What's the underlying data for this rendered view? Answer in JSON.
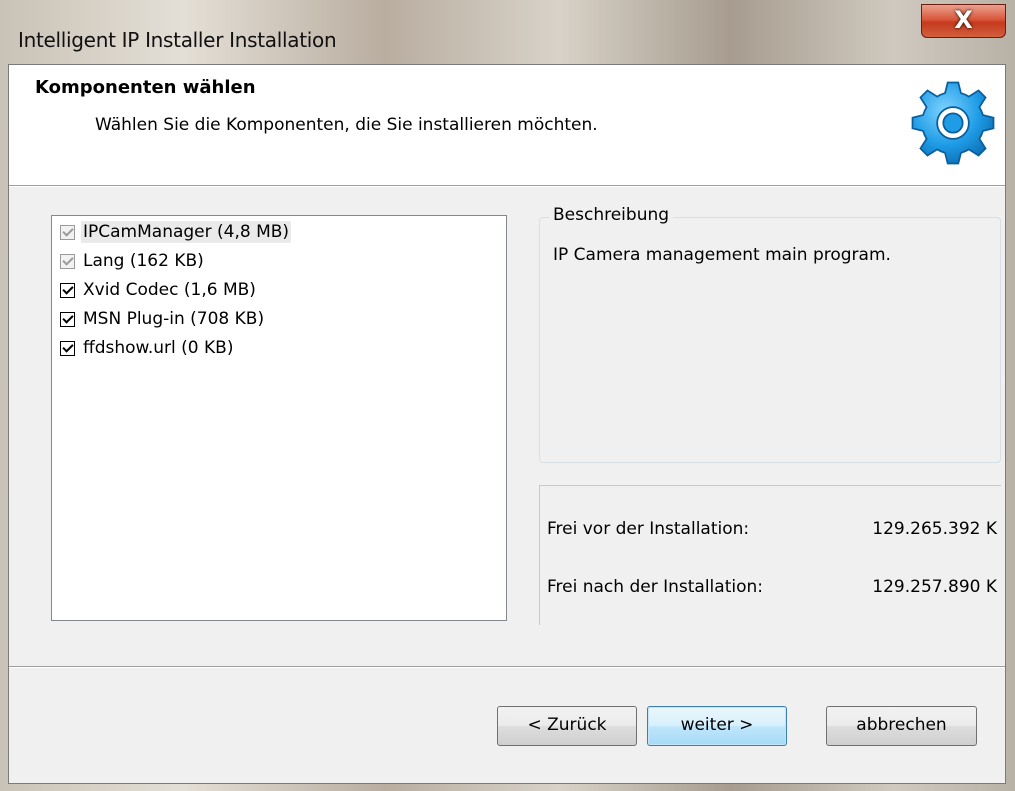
{
  "window": {
    "title": "Intelligent IP Installer Installation",
    "close_symbol": "X"
  },
  "header": {
    "title": "Komponenten wählen",
    "subtitle": "Wählen Sie die Komponenten, die Sie installieren möchten.",
    "icon": "gear-icon"
  },
  "components": [
    {
      "label": "IPCamManager (4,8 MB)",
      "checked": true,
      "disabled": true,
      "selected": true
    },
    {
      "label": "Lang (162 KB)",
      "checked": true,
      "disabled": true,
      "selected": false
    },
    {
      "label": "Xvid Codec (1,6 MB)",
      "checked": true,
      "disabled": false,
      "selected": false
    },
    {
      "label": "MSN Plug-in (708 KB)",
      "checked": true,
      "disabled": false,
      "selected": false
    },
    {
      "label": "ffdshow.url (0 KB)",
      "checked": true,
      "disabled": false,
      "selected": false
    }
  ],
  "description": {
    "label": "Beschreibung",
    "text": "IP Camera management main program."
  },
  "space": {
    "before_label": "Frei vor der Installation:",
    "before_value": "129.265.392 K",
    "after_label": "Frei nach der Installation:",
    "after_value": "129.257.890 K"
  },
  "buttons": {
    "back": "< Zurück",
    "next": "weiter >",
    "cancel": "abbrechen"
  },
  "colors": {
    "close_button": "#d9573b",
    "default_button_border": "#3c7fb1",
    "gear": "#1f9ce6"
  }
}
